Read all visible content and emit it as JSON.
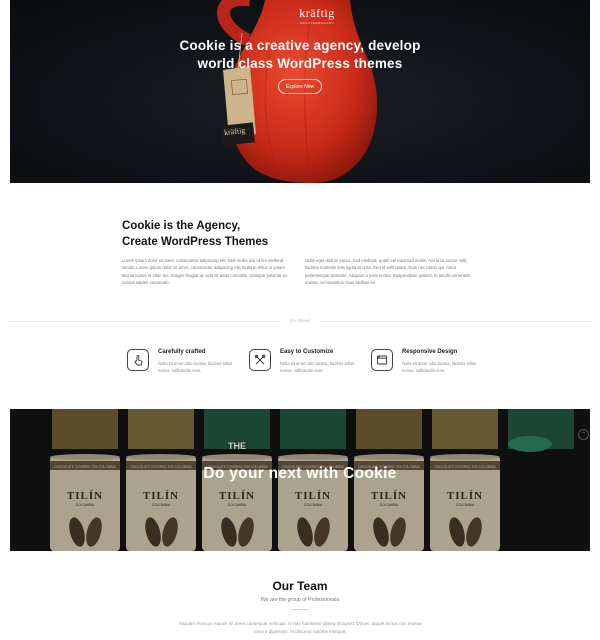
{
  "hero": {
    "brand": "kräftig",
    "brand_sub": "KRÄUTERBRANNT",
    "tag_label": "kräftig",
    "title_line1": "Cookie is a creative agency, develop",
    "title_line2": "world class WordPress themes",
    "button_label": "Explore Now"
  },
  "about": {
    "heading_line1": "Cookie is the Agency,",
    "heading_line2": "Create WordPress Themes",
    "col1": "Lorem ipsum dolor sit amet, consectetur adipiscing elit. Sed mollis nisi ut leo eleifend iaculis. Lorem ipsum dolor sit amet, consectetur adipiscing elit. Nulla in tellus in ipsum lacinia luctus et vitae leo. Integer feugiat ac velit sit amet convallis. Quisque pulvinar ex cursus sapien commodo.",
    "col2": "Nulla eget dictum purus. Sed eleifend, quam vel euismod mollis, nisi arcu auctor velit, facilisis molestie felis ligula at urna. Sed id velit quam. Duis nec purus qui, tortor pellentesque molestie. Aliquam a justo lectus. Suspendisse potenti. In iaculis venenatis massa, vel maximus risus facilisis eu."
  },
  "divider": {
    "label": "Go Ahead"
  },
  "features": [
    {
      "title": "Carefully crafted",
      "text": "Nulla sit amet odio lacinia, facilisis tellus nonus, sollicitudin eros.",
      "icon": "tap-icon"
    },
    {
      "title": "Easy to Customize",
      "text": "Nulla sit amet odio lacinia, facilisis tellus nonus, sollicitudin eros.",
      "icon": "tools-icon"
    },
    {
      "title": "Responsive Design",
      "text": "Nulla sit amet odio lacinia, facilisis tellus nonus, sollicitudin eros.",
      "icon": "browser-icon"
    }
  ],
  "banner": {
    "title": "Do your next with Cookie",
    "can_brand": "TILÍN",
    "can_sub": "COLOMBIA",
    "can_band": "CHOCOLATE COVERED 70% COLOMBIA",
    "back_label": "THE"
  },
  "team": {
    "title": "Our Team",
    "subtitle": "We are the group of Professionals",
    "text": "Aliquam rhoncus mauris sit amet consequat vehicula. In hac habitasse platea dictumst. Donec aliquet lectus non massa viverra dignissim. In placerat lobortis tristique."
  },
  "colors": {
    "vase": "#d8321f",
    "hero_bg": "#0f1216",
    "banner_bg": "#141414",
    "tin_green": "#3a8a68",
    "tin_cream": "#ddd1b8"
  }
}
